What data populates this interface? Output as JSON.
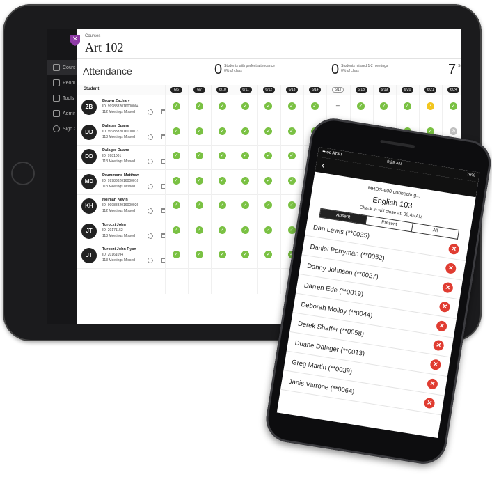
{
  "tablet": {
    "nav": [
      {
        "label": "Courses",
        "icon": "courses-icon"
      },
      {
        "label": "People",
        "icon": "people-icon"
      },
      {
        "label": "Tools",
        "icon": "tools-icon"
      },
      {
        "label": "Admin",
        "icon": "admin-icon"
      },
      {
        "label": "Sign Out",
        "icon": "sign-out-icon"
      }
    ],
    "breadcrumb": "Courses",
    "course_title": "Art 102",
    "attendance_title": "Attendance",
    "stats": [
      {
        "num": "0",
        "line1": "Students with perfect attendance",
        "line2": "0% of class"
      },
      {
        "num": "0",
        "line1": "Students missed 1-2 meetings",
        "line2": "0% of class"
      },
      {
        "num": "7",
        "line1": "St",
        "line2": ""
      }
    ],
    "student_header": "Student",
    "dates": [
      "6/6",
      "6/7",
      "6/10",
      "6/11",
      "6/12",
      "6/13",
      "6/14",
      "6/17",
      "6/18",
      "6/19",
      "6/20",
      "6/21",
      "6/24"
    ],
    "students": [
      {
        "initials": "ZB",
        "name": "Brown Zachary",
        "id": "ID: 9998882016000004",
        "missed": "112 Meetings Missed",
        "marks": [
          "p",
          "p",
          "p",
          "p",
          "p",
          "p",
          "p",
          "-",
          "p",
          "p",
          "p",
          "y",
          "p"
        ]
      },
      {
        "initials": "DD",
        "name": "Dalager Duane",
        "id": "ID: 9998882016000013",
        "missed": "113 Meetings Missed",
        "marks": [
          "p",
          "p",
          "p",
          "p",
          "p",
          "p",
          "p",
          "-",
          "p",
          "p",
          "p",
          "p",
          "g"
        ]
      },
      {
        "initials": "DD",
        "name": "Dalager Duane",
        "id": "ID: 9981001",
        "missed": "113 Meetings Missed",
        "marks": [
          "p",
          "p",
          "p",
          "p",
          "p",
          "p",
          "p",
          "-",
          "p",
          "p",
          "p",
          "p",
          "p"
        ]
      },
      {
        "initials": "MD",
        "name": "Drummond Matthew",
        "id": "ID: 9998882016000016",
        "missed": "113 Meetings Missed",
        "marks": [
          "p",
          "p",
          "p",
          "p",
          "p",
          "p",
          "p",
          "-",
          "p",
          "p",
          "p",
          "p",
          "p"
        ]
      },
      {
        "initials": "KH",
        "name": "Holman Kevin",
        "id": "ID: 9998882016000026",
        "missed": "112 Meetings Missed",
        "marks": [
          "p",
          "p",
          "p",
          "p",
          "p",
          "p",
          "p",
          "-",
          "p",
          "p",
          "p",
          "p",
          "p"
        ]
      },
      {
        "initials": "JT",
        "name": "Turoczi John",
        "id": "ID: 20171152",
        "missed": "113 Meetings Missed",
        "marks": [
          "p",
          "p",
          "p",
          "p",
          "p",
          "p",
          "p",
          "-",
          "p",
          "p",
          "p",
          "p",
          "p"
        ]
      },
      {
        "initials": "JT",
        "name": "Turoczi John Ryan",
        "id": "ID: 20161094",
        "missed": "113 Meetings Missed",
        "marks": [
          "p",
          "p",
          "p",
          "p",
          "p",
          "p",
          "p",
          "-",
          "p",
          "p",
          "p",
          "p",
          "p"
        ]
      }
    ]
  },
  "phone": {
    "carrier": "•••oo AT&T",
    "time": "9:28 AM",
    "battery": "76%",
    "session": "MRDS-600 connecting...",
    "course": "English 103",
    "checkin": "Check in will close at: 08:45 AM",
    "tabs": [
      "Absent",
      "Present",
      "All"
    ],
    "active_tab": "Absent",
    "students": [
      "Dan Lewis (**0035)",
      "Daniel Perryman (**0052)",
      "Danny Johnson (**0027)",
      "Darren Ede (**0019)",
      "Deborah Molloy (**0044)",
      "Derek Shaffer (**0058)",
      "Duane Dalager (**0013)",
      "Greg Martin (**0039)",
      "Janis Varrone (**0064)"
    ]
  }
}
